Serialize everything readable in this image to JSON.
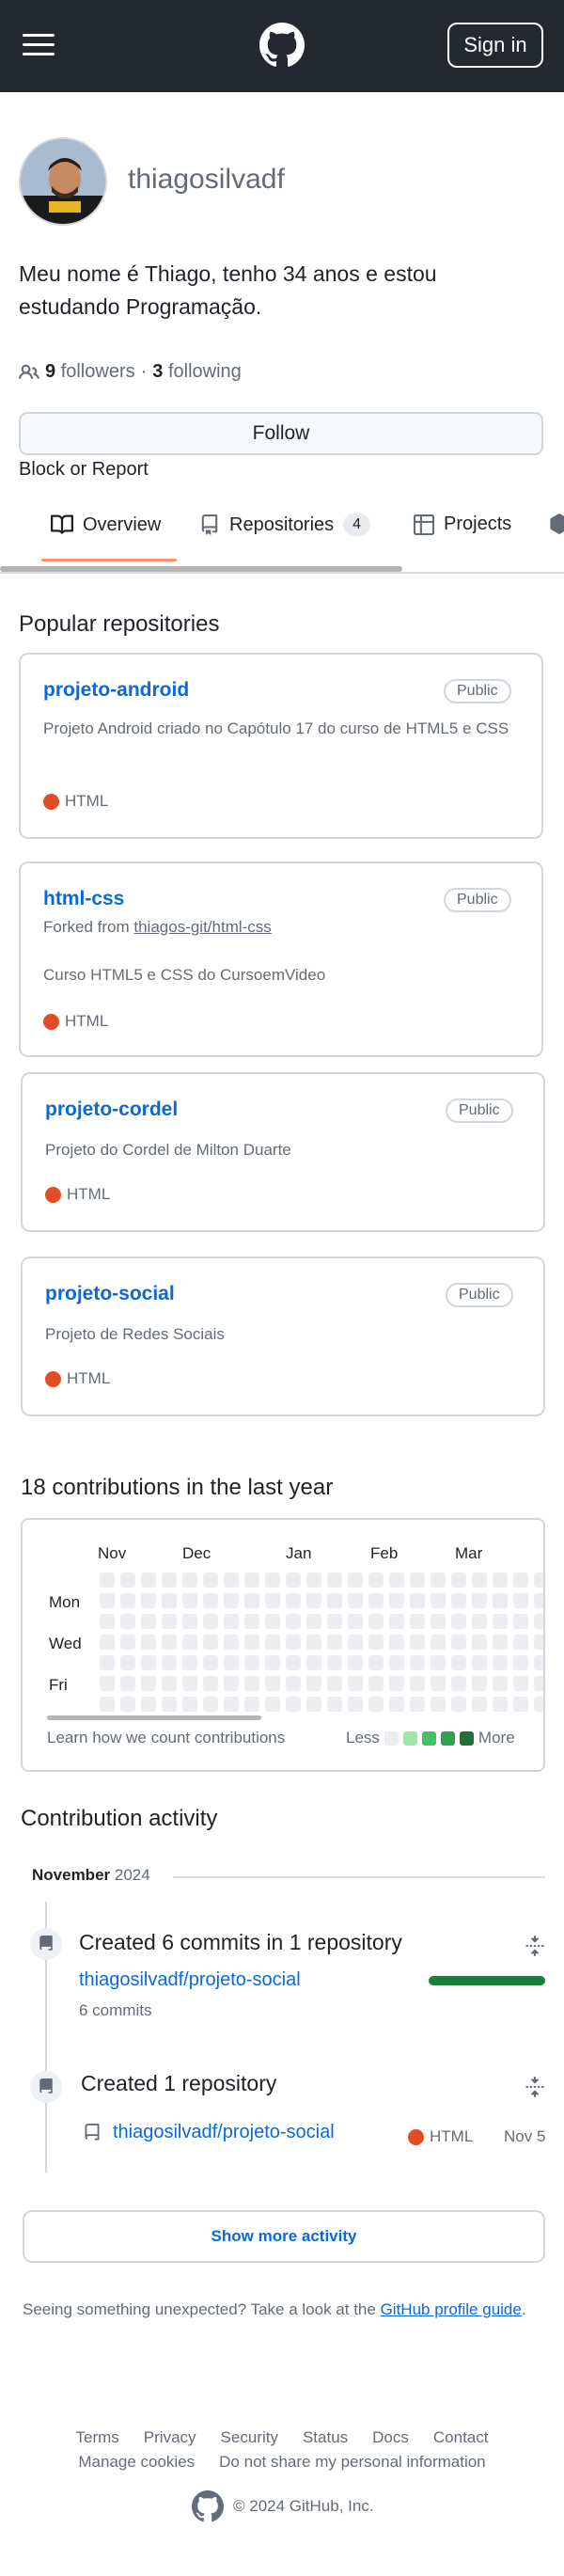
{
  "header": {
    "sign_in": "Sign in"
  },
  "profile": {
    "username": "thiagosilvadf",
    "bio": "Meu nome é Thiago, tenho 34 anos e estou estudando Programação.",
    "followers_count": "9",
    "followers_label": "followers",
    "separator": "·",
    "following_count": "3",
    "following_label": "following",
    "follow_button": "Follow",
    "block_report": "Block or Report"
  },
  "tabs": {
    "overview": "Overview",
    "repositories": "Repositories",
    "repositories_count": "4",
    "projects": "Projects"
  },
  "popular": {
    "title": "Popular repositories",
    "repos": [
      {
        "name": "projeto-android",
        "visibility": "Public",
        "description": "Projeto Android criado no Capótulo 17 do curso de HTML5 e CSS",
        "language": "HTML"
      },
      {
        "name": "html-css",
        "visibility": "Public",
        "forked_prefix": "Forked from",
        "forked_from": "thiagos-git/html-css",
        "description": "Curso HTML5 e CSS do CursoemVideo",
        "language": "HTML"
      },
      {
        "name": "projeto-cordel",
        "visibility": "Public",
        "description": "Projeto do Cordel de Milton Duarte",
        "language": "HTML"
      },
      {
        "name": "projeto-social",
        "visibility": "Public",
        "description": "Projeto de Redes Sociais",
        "language": "HTML"
      }
    ],
    "language_color": "#e34c26"
  },
  "contributions": {
    "title": "18 contributions in the last year",
    "months": [
      "Nov",
      "Dec",
      "Jan",
      "Feb",
      "Mar"
    ],
    "days": [
      "Mon",
      "Wed",
      "Fri"
    ],
    "learn": "Learn how we count contributions",
    "less": "Less",
    "more": "More",
    "legend_colors": [
      "#ebedf0",
      "#9be9a8",
      "#40c463",
      "#30a14e",
      "#216e39"
    ]
  },
  "activity": {
    "title": "Contribution activity",
    "month": "November",
    "year": "2024",
    "item1": {
      "title": "Created 6 commits in 1 repository",
      "repo": "thiagosilvadf/projeto-social",
      "commits": "6 commits"
    },
    "item2": {
      "title": "Created 1 repository",
      "repo": "thiagosilvadf/projeto-social",
      "language": "HTML",
      "date": "Nov 5"
    },
    "show_more": "Show more activity",
    "unexpected_text": "Seeing something unexpected? Take a look at the",
    "guide_link": "GitHub profile guide",
    "unexpected_end": "."
  },
  "footer": {
    "links_row1": [
      "Terms",
      "Privacy",
      "Security",
      "Status",
      "Docs",
      "Contact"
    ],
    "links_row2": [
      "Manage cookies",
      "Do not share my personal information"
    ],
    "copyright": "© 2024 GitHub, Inc."
  }
}
